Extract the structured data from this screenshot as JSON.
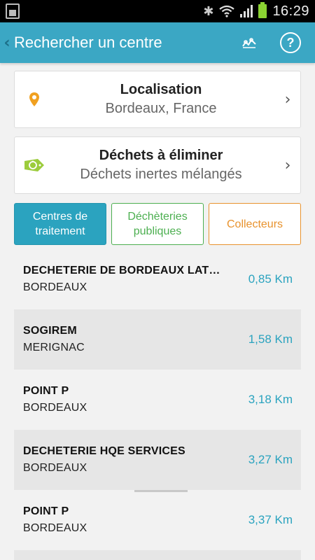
{
  "status_bar": {
    "time": "16:29",
    "icons": [
      "sim-icon",
      "bluetooth-icon",
      "wifi-icon",
      "signal-icon",
      "battery-icon"
    ]
  },
  "app_bar": {
    "title": "Rechercher un centre",
    "icons": [
      "back-chevron-icon",
      "map-icon",
      "help-icon"
    ],
    "help_glyph": "?"
  },
  "location_card": {
    "title": "Localisation",
    "value": "Bordeaux, France",
    "icon": "location-pin-icon"
  },
  "waste_card": {
    "title": "Déchets à éliminer",
    "value": "Déchets inertes mélangés",
    "icon": "recycle-icon"
  },
  "tabs": [
    {
      "label": "Centres de traitement",
      "selected": true
    },
    {
      "label": "Déchèteries publiques",
      "selected": false
    },
    {
      "label": "Collecteurs",
      "selected": false
    }
  ],
  "centers": [
    {
      "name": "DECHETERIE DE BORDEAUX LATU…",
      "city": "BORDEAUX",
      "distance": "0,85 Km"
    },
    {
      "name": "SOGIREM",
      "city": "MERIGNAC",
      "distance": "1,58 Km"
    },
    {
      "name": "POINT P",
      "city": "BORDEAUX",
      "distance": "3,18 Km"
    },
    {
      "name": "DECHETERIE HQE SERVICES",
      "city": "BORDEAUX",
      "distance": "3,27 Km"
    },
    {
      "name": "POINT P",
      "city": "BORDEAUX",
      "distance": "3,37 Km"
    }
  ],
  "colors": {
    "accent": "#3ba7c4",
    "distance": "#2ba3bf",
    "green": "#4caf50",
    "orange": "#e8922d",
    "pin": "#f0a020",
    "recycle": "#9ccc3c"
  }
}
